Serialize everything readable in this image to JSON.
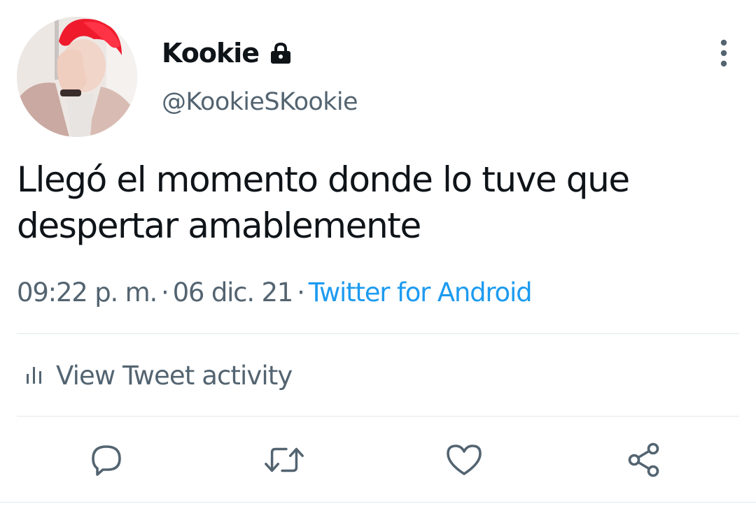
{
  "user": {
    "display_name": "Kookie",
    "handle": "@KookieSKookie",
    "protected_icon": "lock-icon"
  },
  "tweet": {
    "text": "Llegó el momento donde lo tuve que despertar amablemente",
    "time": "09:22 p. m.",
    "date": "06 dic. 21",
    "separator": "·",
    "source": "Twitter for Android"
  },
  "activity": {
    "label": "View Tweet activity",
    "icon": "bar-chart-icon"
  },
  "actions": [
    {
      "name": "reply",
      "icon": "reply-icon"
    },
    {
      "name": "retweet",
      "icon": "retweet-icon"
    },
    {
      "name": "like",
      "icon": "heart-icon"
    },
    {
      "name": "share",
      "icon": "share-icon"
    }
  ],
  "colors": {
    "text_primary": "#0f1419",
    "text_secondary": "#536471",
    "link": "#1d9bf0",
    "divider": "#e1e8ed"
  }
}
